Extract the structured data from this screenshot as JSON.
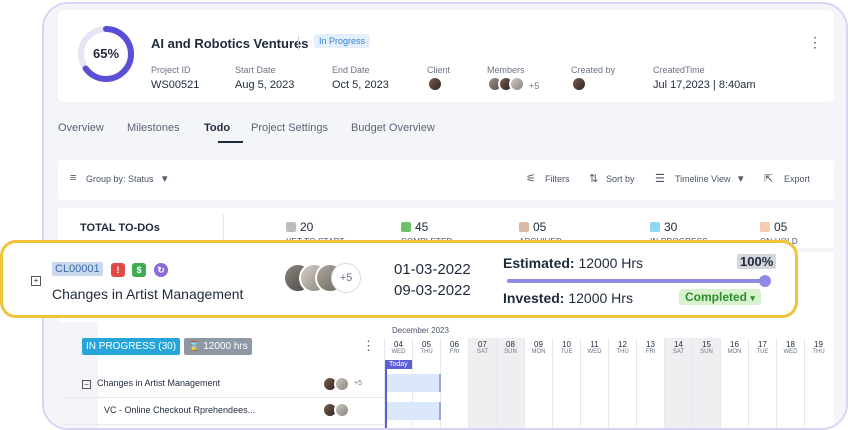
{
  "project": {
    "progress_label": "65%",
    "progress_value": 65,
    "name": "AI and Robotics Ventures",
    "status": "In Progress",
    "fields": [
      {
        "label": "Project ID",
        "value": "WS00521"
      },
      {
        "label": "Start Date",
        "value": "Aug 5, 2023"
      },
      {
        "label": "End Date",
        "value": "Oct 5, 2023"
      },
      {
        "label": "Client",
        "value": ""
      },
      {
        "label": "Members",
        "value": ""
      },
      {
        "label": "Created by",
        "value": ""
      },
      {
        "label": "CreatedTime",
        "value": "Jul 17,2023 | 8:40am"
      }
    ],
    "members_more": "+5",
    "accent_color": "#5b4fd6"
  },
  "tabs": [
    "Overview",
    "Milestones",
    "Todo",
    "Project Settings",
    "Budget Overview"
  ],
  "active_tab": "Todo",
  "toolbar": {
    "group_by": "Group by: Status",
    "filters": "Filters",
    "sort_by": "Sort by",
    "view": "Timeline View",
    "export": "Export"
  },
  "summary": {
    "title": "TOTAL TO-DOs",
    "stats": [
      {
        "count": "20",
        "label": "YET TO START",
        "color": "#bdbdbd"
      },
      {
        "count": "45",
        "label": "COMPLETED",
        "color": "#6fc06a"
      },
      {
        "count": "05",
        "label": "ARCHIVED",
        "color": "#d9b8a4"
      },
      {
        "count": "30",
        "label": "IN PROGRESS",
        "color": "#8fd8ef"
      },
      {
        "count": "05",
        "label": "ON HOLD",
        "color": "#f5cdb0"
      }
    ],
    "partial_label": "ED"
  },
  "highlight": {
    "id": "CL00001",
    "name": "Changes in Artist Management",
    "members_more": "+5",
    "start_date": "01-03-2022",
    "end_date": "09-03-2022",
    "estimated_label": "Estimated:",
    "estimated_value": "12000 Hrs",
    "invested_label": "Invested:",
    "invested_value": "12000 Hrs",
    "progress_label": "100%",
    "progress_value": 100,
    "status": "Completed",
    "status_caret": "▾"
  },
  "group": {
    "status_chip": "IN PROGRESS (30)",
    "hours_chip": "⌛ 12000 hrs",
    "rows": [
      {
        "label": "Changes in Artist Management",
        "more": "+5"
      },
      {
        "label": "VC - Online Checkout Rprehendees..."
      }
    ]
  },
  "timeline": {
    "month": "December 2023",
    "today_label": "Today",
    "days": [
      {
        "n": "04",
        "w": "WED",
        "weekend": false
      },
      {
        "n": "05",
        "w": "THU",
        "weekend": false
      },
      {
        "n": "06",
        "w": "FRI",
        "weekend": false
      },
      {
        "n": "07",
        "w": "SAT",
        "weekend": true
      },
      {
        "n": "08",
        "w": "SUN",
        "weekend": true
      },
      {
        "n": "09",
        "w": "MON",
        "weekend": false
      },
      {
        "n": "10",
        "w": "TUE",
        "weekend": false
      },
      {
        "n": "11",
        "w": "WED",
        "weekend": false
      },
      {
        "n": "12",
        "w": "THU",
        "weekend": false
      },
      {
        "n": "13",
        "w": "FRI",
        "weekend": false
      },
      {
        "n": "14",
        "w": "SAT",
        "weekend": true
      },
      {
        "n": "15",
        "w": "SUN",
        "weekend": true
      },
      {
        "n": "16",
        "w": "MON",
        "weekend": false
      },
      {
        "n": "17",
        "w": "TUE",
        "weekend": false
      },
      {
        "n": "18",
        "w": "WED",
        "weekend": false
      },
      {
        "n": "19",
        "w": "THU",
        "weekend": false
      }
    ]
  }
}
